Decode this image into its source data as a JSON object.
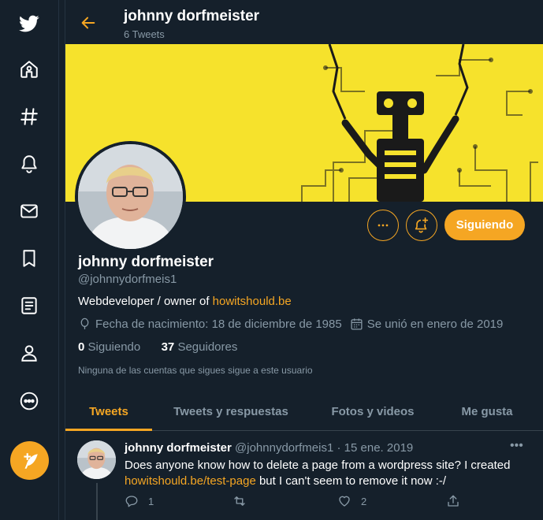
{
  "colors": {
    "accent": "#f5a623",
    "background": "#15202b",
    "muted": "#8899a6",
    "border": "#38444d",
    "banner": "#f6e22c"
  },
  "nav": {
    "items": [
      {
        "icon": "twitter-bird-icon"
      },
      {
        "icon": "home-icon"
      },
      {
        "icon": "explore-hashtag-icon"
      },
      {
        "icon": "notifications-bell-icon"
      },
      {
        "icon": "messages-envelope-icon"
      },
      {
        "icon": "bookmarks-icon"
      },
      {
        "icon": "lists-icon"
      },
      {
        "icon": "profile-icon"
      },
      {
        "icon": "more-icon"
      },
      {
        "icon": "compose-tweet-icon"
      }
    ]
  },
  "header": {
    "title": "johnny dorfmeister",
    "subtitle": "6 Tweets"
  },
  "profile": {
    "name": "johnny dorfmeister",
    "handle": "@johnnydorfmeis1",
    "bio_text": "Webdeveloper / owner of ",
    "bio_link": "howitshould.be",
    "birthday": "Fecha de nacimiento: 18 de diciembre de 1985",
    "joined": "Se unió en enero de 2019",
    "following_count": "0",
    "following_label": " Siguiendo",
    "followers_count": "37",
    "followers_label": " Seguidores",
    "mutual_note": "Ninguna de las cuentas que sigues sigue a este usuario",
    "follow_button": "Siguiendo"
  },
  "tabs": [
    {
      "label": "Tweets",
      "active": true
    },
    {
      "label": "Tweets y respuestas",
      "active": false
    },
    {
      "label": "Fotos y videos",
      "active": false
    },
    {
      "label": "Me gusta",
      "active": false
    }
  ],
  "tweet": {
    "name": "johnny dorfmeister",
    "handle": "@johnnydorfmeis1",
    "separator": " · ",
    "date": "15 ene. 2019",
    "more": "•••",
    "text_1": "Does anyone know how to delete a page from a wordpress site? I created ",
    "link": "howitshould.be/test-page",
    "text_2": " but I can't seem to remove it now :-/",
    "reply_count": "1",
    "retweet_count": "",
    "like_count": "2"
  }
}
